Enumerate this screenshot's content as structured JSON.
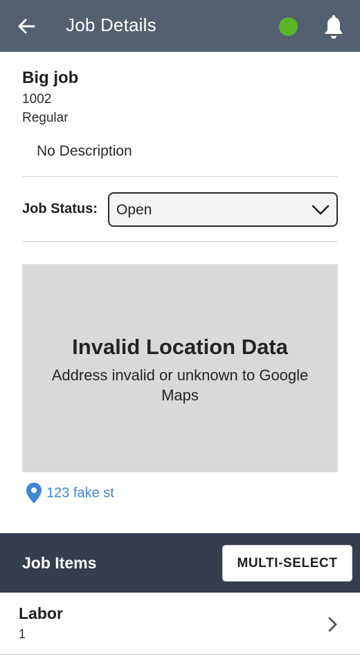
{
  "appbar": {
    "title": "Job Details",
    "back_icon": "arrow-left-icon",
    "status_color": "#5bb527",
    "bell_icon": "bell-icon"
  },
  "job": {
    "name": "Big job",
    "number": "1002",
    "type": "Regular",
    "description": "No Description"
  },
  "status": {
    "label": "Job Status:",
    "value": "Open"
  },
  "map": {
    "title": "Invalid Location Data",
    "message": "Address invalid or unknown to Google Maps"
  },
  "address": {
    "icon": "map-pin-icon",
    "text": "123 fake st"
  },
  "items": {
    "title": "Job Items",
    "multi_select_label": "MULTI-SELECT",
    "list": [
      {
        "name": "Labor",
        "quantity": "1"
      }
    ]
  },
  "colors": {
    "appbar": "#536071",
    "items_bar": "#343f4d",
    "link": "#3f86d2"
  }
}
